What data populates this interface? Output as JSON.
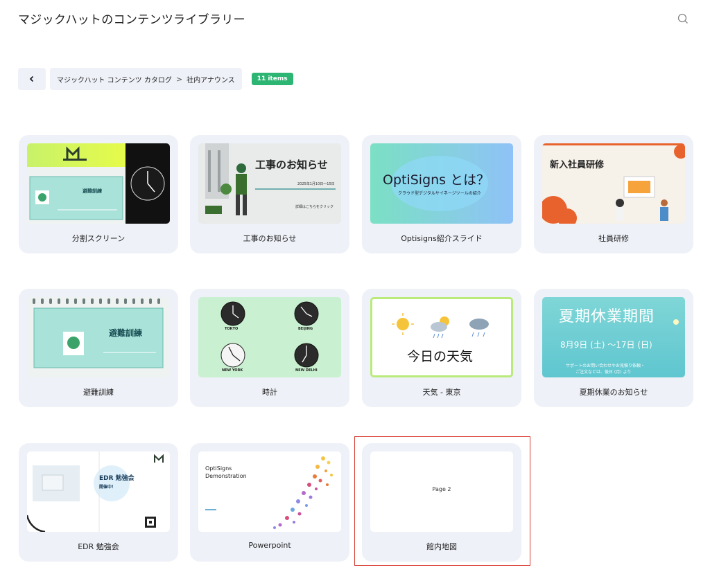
{
  "header": {
    "title": "マジックハットのコンテンツライブラリー"
  },
  "breadcrumb": {
    "root": "マジックハット コンテンツ カタログ",
    "separator": ">",
    "current": "社内アナウンス",
    "count": "11 items"
  },
  "colors": {
    "badge": "#2db673",
    "card_bg": "#eef1f8",
    "highlight_border": "#d63a2f"
  },
  "cards": [
    {
      "label": "分割スクリーン",
      "thumb": {
        "notice_title": "避難訓練"
      }
    },
    {
      "label": "工事のお知らせ",
      "thumb": {
        "heading": "工事のお知らせ",
        "date": "2025年1月10日〜15日",
        "cta": "詳細はこちらをクリック"
      }
    },
    {
      "label": "Optisigns紹介スライド",
      "thumb": {
        "heading": "OptiSigns とは？",
        "sub": "クラウド型デジタルサイネージツールの紹介"
      }
    },
    {
      "label": "社員研修",
      "thumb": {
        "heading": "新入社員研修"
      }
    },
    {
      "label": "避難訓練",
      "thumb": {
        "heading": "避難訓練"
      }
    },
    {
      "label": "時計",
      "thumb": {
        "cities": [
          "TOKYO",
          "BEIJING",
          "NEW YORK",
          "NEW DELHI"
        ]
      }
    },
    {
      "label": "天気 - 東京",
      "thumb": {
        "heading": "今日の天気"
      }
    },
    {
      "label": "夏期休業のお知らせ",
      "thumb": {
        "heading": "夏期休業期間",
        "dates": "8月9日 (土) 〜17日 (日)",
        "note1": "サポートのお問い合わせやお見積り依頼・",
        "note2": "ご注文などは、後日 (月) より"
      }
    },
    {
      "label": "EDR 勉強会",
      "thumb": {
        "heading": "EDR 勉強会",
        "status": "開催中！"
      }
    },
    {
      "label": "Powerpoint",
      "thumb": {
        "line1": "OptiSigns",
        "line2": "Demonstration"
      }
    },
    {
      "label": "館内地図",
      "thumb": {
        "text": "Page 2"
      }
    }
  ],
  "icons": {
    "search": "search-icon",
    "back": "chevron-left-icon",
    "running_man": "emergency-exit-icon"
  }
}
